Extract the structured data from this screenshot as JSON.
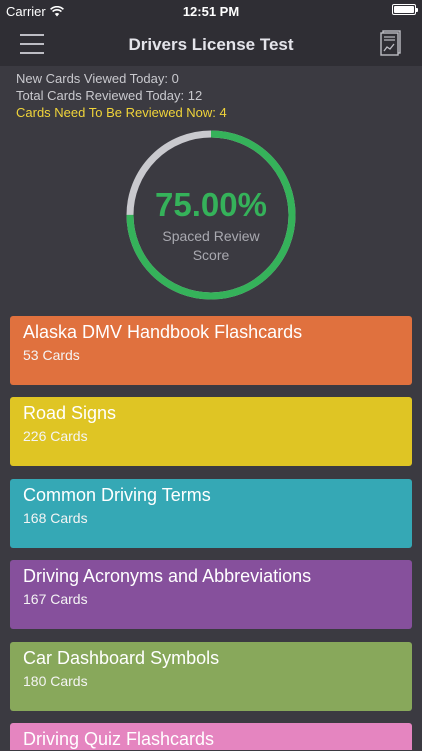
{
  "status": {
    "carrier": "Carrier",
    "time": "12:51 PM"
  },
  "nav": {
    "title": "Drivers License Test",
    "menu_icon": "hamburger-menu-icon",
    "report_icon": "report-chart-icon"
  },
  "stats": {
    "new_viewed": "New Cards Viewed Today: 0",
    "total_reviewed": "Total Cards Reviewed Today: 12",
    "due_now": "Cards Need To Be Reviewed Now: 4"
  },
  "score": {
    "percent_label": "75.00%",
    "percent": 75,
    "label_line1": "Spaced Review",
    "label_line2": "Score",
    "progress_color": "#35b25a",
    "track_color": "#c9c9ce"
  },
  "decks": [
    {
      "title": "Alaska DMV Handbook Flashcards",
      "count": "53 Cards",
      "color": "#e0713e"
    },
    {
      "title": "Road Signs",
      "count": "226 Cards",
      "color": "#dfc524"
    },
    {
      "title": "Common Driving Terms",
      "count": "168 Cards",
      "color": "#35a8b5"
    },
    {
      "title": "Driving Acronyms and Abbreviations",
      "count": "167 Cards",
      "color": "#86509c"
    },
    {
      "title": "Car Dashboard Symbols",
      "count": "180 Cards",
      "color": "#88a85b"
    },
    {
      "title": "Driving Quiz Flashcards",
      "count": "",
      "color": "#e585c0"
    }
  ]
}
